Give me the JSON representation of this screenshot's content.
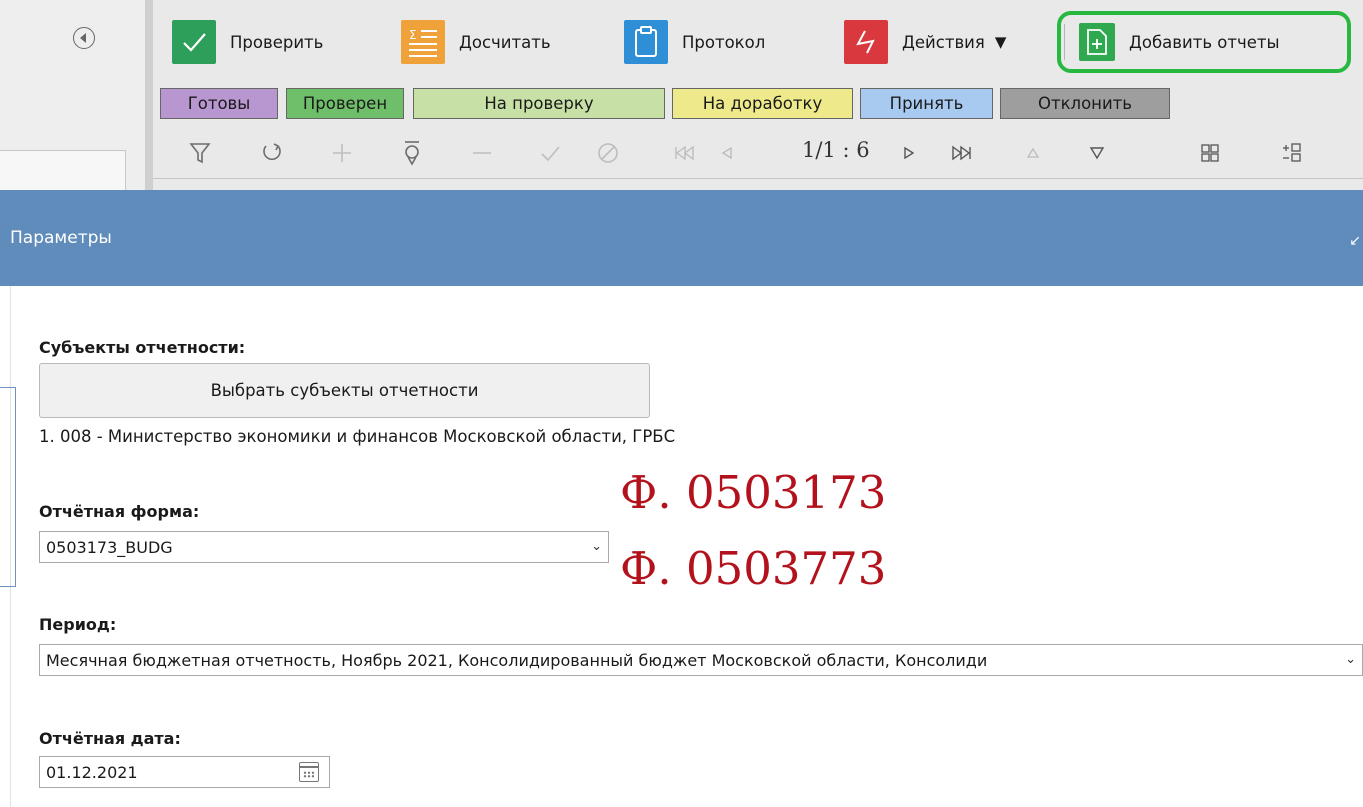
{
  "toolbar": {
    "actions": [
      {
        "label": "Проверить",
        "color": "#2e9e5b",
        "icon": "check-icon"
      },
      {
        "label": "Досчитать",
        "color": "#f0a23a",
        "icon": "sigma-list-icon"
      },
      {
        "label": "Протокол",
        "color": "#2f8fd6",
        "icon": "clipboard-icon"
      },
      {
        "label": "Действия",
        "color": "#d9393e",
        "icon": "lightning-icon",
        "caret": "▼"
      },
      {
        "label": "Добавить отчеты",
        "color": "#2fa84f",
        "icon": "add-document-icon"
      }
    ],
    "statuses": [
      {
        "label": "Готовы",
        "color": "#b897d1"
      },
      {
        "label": "Проверен",
        "color": "#6fbf6a"
      },
      {
        "label": "На проверку",
        "color": "#c7e0a6"
      },
      {
        "label": "На доработку",
        "color": "#eeea8c"
      },
      {
        "label": "Принять",
        "color": "#a9caf0"
      },
      {
        "label": "Отклонить",
        "color": "#9e9e9e"
      }
    ],
    "pager": "1/1 : 6",
    "nav_icons": [
      "filter-icon",
      "refresh-icon",
      "add-icon",
      "filter-clear-icon",
      "remove-icon",
      "confirm-icon",
      "cancel-icon",
      "first-page-icon",
      "prev-page-icon",
      "next-page-icon",
      "last-page-icon",
      "up-icon",
      "down-icon",
      "grid-icon",
      "expand-icon"
    ]
  },
  "dialog": {
    "title": "Параметры",
    "header_color": "#5f8cbb",
    "entities_label": "Субъекты отчетности:",
    "choose_button": "Выбрать субъекты отчетности",
    "entity_item": "1. 008 - Министерство экономики и финансов Московской области, ГРБС",
    "form_label": "Отчётная форма:",
    "form_value": "0503173_BUDG",
    "period_label": "Период:",
    "period_value": "Месячная бюджетная отчетность, Ноябрь 2021, Консолидированный бюджет Московской области, Консолиди",
    "date_label": "Отчётная дата:",
    "date_value": "01.12.2021"
  },
  "annotation": {
    "form_1": "Ф. 0503173",
    "form_2": "Ф. 0503773",
    "color": "#b3121c",
    "highlight_color": "#28b83f"
  }
}
